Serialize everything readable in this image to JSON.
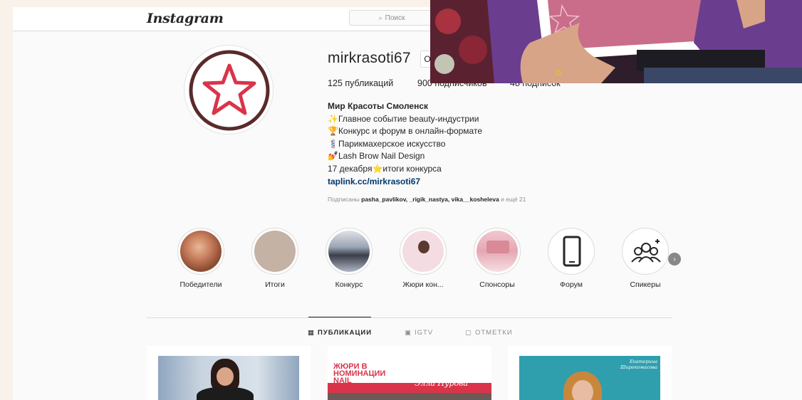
{
  "nav": {
    "logo": "Instagram",
    "search_placeholder": "Поиск"
  },
  "profile": {
    "username": "mirkrasoti67",
    "edit_label": "О",
    "stats": {
      "posts": "125 публикаций",
      "followers": "900 подписчиков",
      "following": "48 подписок"
    },
    "bio": {
      "name": "Мир Красоты Смоленск",
      "line1": "✨Главное событие beauty-индустрии",
      "line2": "🏆Конкурс и форум в онлайн-формате",
      "line3": "💈Парикмахерское искусство",
      "line4": "💅Lash Brow Nail Design",
      "line5": "17 декабря⭐итоги конкурса",
      "link": "taplink.cc/mirkrasoti67"
    },
    "followed_prefix": "Подписаны",
    "followed_names": "pasha_pavlikov, _rigik_nastya, vika__kosheleva",
    "followed_suffix": "и ещё 21"
  },
  "highlights": [
    {
      "label": "Победители"
    },
    {
      "label": "Итоги"
    },
    {
      "label": "Конкурс"
    },
    {
      "label": "Жюри кон..."
    },
    {
      "label": "Спонсоры"
    },
    {
      "label": "Форум"
    },
    {
      "label": "Спикеры"
    }
  ],
  "tabs": {
    "posts": "ПУБЛИКАЦИИ",
    "igtv": "IGTV",
    "tagged": "ОТМЕТКИ"
  },
  "posts": {
    "post2_title": "ЖЮРИ В НОМИНАЦИИ NAIL",
    "post2_name": "Элла Нурова",
    "post3_name": "Екатерина Широкомасова"
  },
  "colors": {
    "brand_red": "#d9344a",
    "ring_dark": "#5a2a2a",
    "link": "#00376b",
    "muted": "#8e8e8e"
  }
}
